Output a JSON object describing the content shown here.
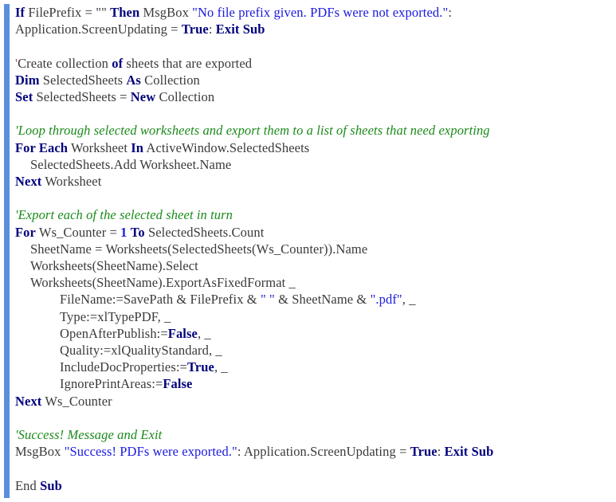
{
  "document": {
    "kind": "vba-code-snippet",
    "language": "VBA",
    "accent_bar_color": "#5b8fdd",
    "background_color": "#ffffff",
    "colors": {
      "plain_text": "#3a3a3a",
      "keyword": "#00007c",
      "string": "#1a1ae0",
      "comment": "#1a8a1a",
      "tick_mark": "#9c5a4a"
    }
  },
  "code": {
    "line01": {
      "kw_if": "If",
      "var_fileprefix": "FilePrefix",
      "op_eq": "=",
      "empty_string": "\"\"",
      "kw_then": "Then",
      "fn_msgbox": "MsgBox",
      "msg_open_quote": "\"No",
      "msg_w1": "file",
      "msg_w2": "prefix",
      "msg_w3": "given.",
      "msg_w4": "PDFs",
      "msg_w5": "were",
      "msg_w6": "not",
      "msg_w7": "exported.\"",
      "colon": ":"
    },
    "line02": {
      "obj": "Application.ScreenUpdating",
      "op_eq": "=",
      "kw_true": "True",
      "colon": ":",
      "kw_exit_sub": "Exit Sub"
    },
    "line03": {
      "tick": "'",
      "text_a": "Create collection ",
      "kw_of": "of",
      "text_b": " sheets that are exported"
    },
    "line04": {
      "kw_dim": "Dim",
      "var": "SelectedSheets",
      "kw_as": "As",
      "type": "Collection"
    },
    "line05": {
      "kw_set": "Set",
      "var": "SelectedSheets",
      "op_eq": "=",
      "kw_new": "New",
      "type": "Collection"
    },
    "line06": {
      "comment": "'Loop through selected worksheets and export them to a list of sheets that need exporting"
    },
    "line07": {
      "kw_for_each": "For Each",
      "var": "Worksheet",
      "kw_in": "In",
      "expr": "ActiveWindow.SelectedSheets"
    },
    "line08": {
      "stmt": "SelectedSheets.Add Worksheet.Name"
    },
    "line09": {
      "kw_next": "Next",
      "var": "Worksheet"
    },
    "line10": {
      "comment": "'Export each of the selected sheet in turn"
    },
    "line11": {
      "kw_for": "For",
      "var": "Ws_Counter",
      "op_eq": "=",
      "num_one": "1",
      "kw_to": "To",
      "expr": "SelectedSheets.Count"
    },
    "line12": {
      "stmt": "SheetName = Worksheets(SelectedSheets(Ws_Counter)).Name"
    },
    "line13": {
      "stmt": "Worksheets(SheetName).Select"
    },
    "line14": {
      "stmt": "Worksheets(SheetName).ExportAsFixedFormat _"
    },
    "line15": {
      "prefix": "FileName:=SavePath & FilePrefix & ",
      "str_space": "\" \"",
      "mid": " & SheetName & ",
      "str_pdf": "\".pdf\"",
      "suffix": ", _"
    },
    "line16": {
      "stmt": "Type:=xlTypePDF, _"
    },
    "line17": {
      "prefix": "OpenAfterPublish:=",
      "kw_false": "False",
      "suffix": ", _"
    },
    "line18": {
      "stmt": "Quality:=xlQualityStandard, _"
    },
    "line19": {
      "prefix": "IncludeDocProperties:=",
      "kw_true": "True",
      "suffix": ", _"
    },
    "line20": {
      "prefix": "IgnorePrintAreas:=",
      "kw_false": "False"
    },
    "line21": {
      "kw_next": "Next",
      "var": "Ws_Counter"
    },
    "line22": {
      "comment": "'Success! Message and Exit"
    },
    "line23": {
      "fn_msgbox": "MsgBox",
      "str_msg": "\"Success! PDFs were exported.\"",
      "colon1": ":",
      "obj": "Application.ScreenUpdating",
      "op_eq": "=",
      "kw_true": "True",
      "colon2": ":",
      "kw_exit_sub": "Exit Sub"
    },
    "line24": {
      "text_end": "End ",
      "kw_sub": "Sub"
    }
  }
}
